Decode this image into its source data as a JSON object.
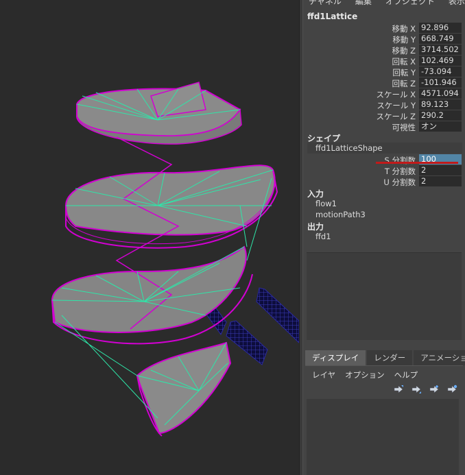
{
  "menubar": [
    "チャネル",
    "編集",
    "オブジェクト",
    "表示"
  ],
  "object_name": "ffd1Lattice",
  "transform_attrs": [
    {
      "label": "移動 X",
      "value": "92.896"
    },
    {
      "label": "移動 Y",
      "value": "668.749"
    },
    {
      "label": "移動 Z",
      "value": "3714.502"
    },
    {
      "label": "回転 X",
      "value": "102.469"
    },
    {
      "label": "回転 Y",
      "value": "-73.094"
    },
    {
      "label": "回転 Z",
      "value": "-101.946"
    },
    {
      "label": "スケール X",
      "value": "4571.094"
    },
    {
      "label": "スケール Y",
      "value": "89.123"
    },
    {
      "label": "スケール Z",
      "value": "290.2"
    },
    {
      "label": "可視性",
      "value": "オン"
    }
  ],
  "shape_section": {
    "title": "シェイプ",
    "name": "ffd1LatticeShape",
    "attrs": [
      {
        "label": "S 分割数",
        "value": "100"
      },
      {
        "label": "T 分割数",
        "value": "2"
      },
      {
        "label": "U 分割数",
        "value": "2"
      }
    ]
  },
  "inputs_section": {
    "title": "入力",
    "items": [
      "flow1",
      "motionPath3"
    ]
  },
  "outputs_section": {
    "title": "出力",
    "items": [
      "ffd1"
    ]
  },
  "layer_tabs": [
    "ディスプレイ",
    "レンダー",
    "アニメーション"
  ],
  "layer_menu": [
    "レイヤ",
    "オプション",
    "ヘルプ"
  ],
  "icons": [
    "layer-move-up-icon",
    "layer-move-down-icon",
    "new-empty-layer-icon",
    "new-layer-from-selection-icon"
  ],
  "colors": {
    "viewport_bg": "#2b2b2b",
    "lattice_magenta": "#d200d2",
    "lattice_green": "#2ee6a8",
    "selected_field": "#5285a6",
    "underline_red": "#c21a1a"
  }
}
